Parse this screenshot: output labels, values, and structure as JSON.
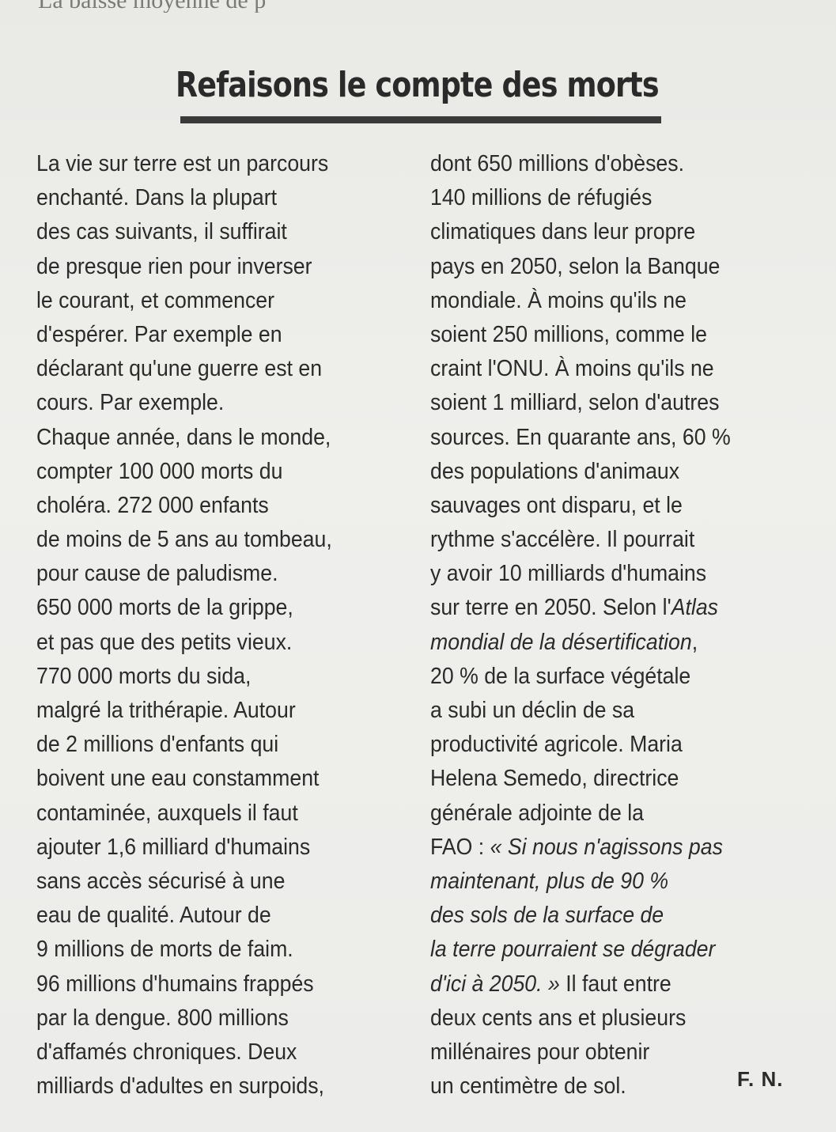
{
  "article": {
    "top_fragment": "La baisse moyenne de p",
    "headline": "Refaisons le compte des morts",
    "left_column": [
      "La vie sur terre est un parcours",
      "enchanté. Dans la plupart",
      "des cas suivants, il suffirait",
      "de presque rien pour inverser",
      "le courant, et commencer",
      "d'espérer. Par exemple en",
      "déclarant qu'une guerre est en",
      "cours. Par exemple.",
      "Chaque année, dans le monde,",
      "compter 100 000 morts du",
      "choléra. 272 000 enfants",
      "de moins de 5 ans au tombeau,",
      "pour cause de paludisme.",
      "650 000 morts de la grippe,",
      "et pas que des petits vieux.",
      "770 000 morts du sida,",
      "malgré la trithérapie. Autour",
      "de 2 millions d'enfants qui",
      "boivent une eau constamment",
      "contaminée, auxquels il faut",
      "ajouter 1,6 milliard d'humains",
      "sans accès sécurisé à une",
      "eau de qualité. Autour de",
      "9 millions de morts de faim.",
      "96 millions d'humains frappés",
      "par la dengue. 800 millions",
      "d'affamés chroniques. Deux",
      "milliards d'adultes en surpoids,"
    ],
    "right_column": [
      {
        "text": "dont 650 millions d'obèses."
      },
      {
        "text": "140 millions de réfugiés"
      },
      {
        "text": "climatiques dans leur propre"
      },
      {
        "text": "pays en 2050, selon la Banque"
      },
      {
        "text": "mondiale. À moins qu'ils ne"
      },
      {
        "text": "soient 250 millions, comme le"
      },
      {
        "text": "craint l'ONU. À moins qu'ils ne"
      },
      {
        "text": "soient 1 milliard, selon d'autres"
      },
      {
        "text": "sources. En quarante ans, 60 %"
      },
      {
        "text": "des populations d'animaux"
      },
      {
        "text": "sauvages ont disparu, et le"
      },
      {
        "text": "rythme s'accélère. Il pourrait"
      },
      {
        "text": "y avoir 10 milliards d'humains"
      },
      {
        "text": "sur terre en 2050. Selon l'",
        "italic_tail": "Atlas"
      },
      {
        "italic_text": "mondial de la désertification",
        "text_after": ","
      },
      {
        "text": "20 % de la surface végétale"
      },
      {
        "text": "a subi un déclin de sa"
      },
      {
        "text": "productivité agricole. Maria"
      },
      {
        "text": "Helena Semedo, directrice"
      },
      {
        "text": "générale adjointe de la"
      },
      {
        "text": "FAO : ",
        "italic_tail": "« Si nous n'agissons pas"
      },
      {
        "italic_text": "maintenant, plus de 90 %"
      },
      {
        "italic_text": "des sols de la surface de"
      },
      {
        "italic_text": "la terre pourraient se dégrader"
      },
      {
        "italic_text": "d'ici à 2050. »",
        "text_after": " Il faut entre"
      },
      {
        "text": "deux cents ans et plusieurs"
      },
      {
        "text": "millénaires pour obtenir"
      },
      {
        "text": "un centimètre de sol."
      }
    ],
    "signature": "F. N."
  }
}
